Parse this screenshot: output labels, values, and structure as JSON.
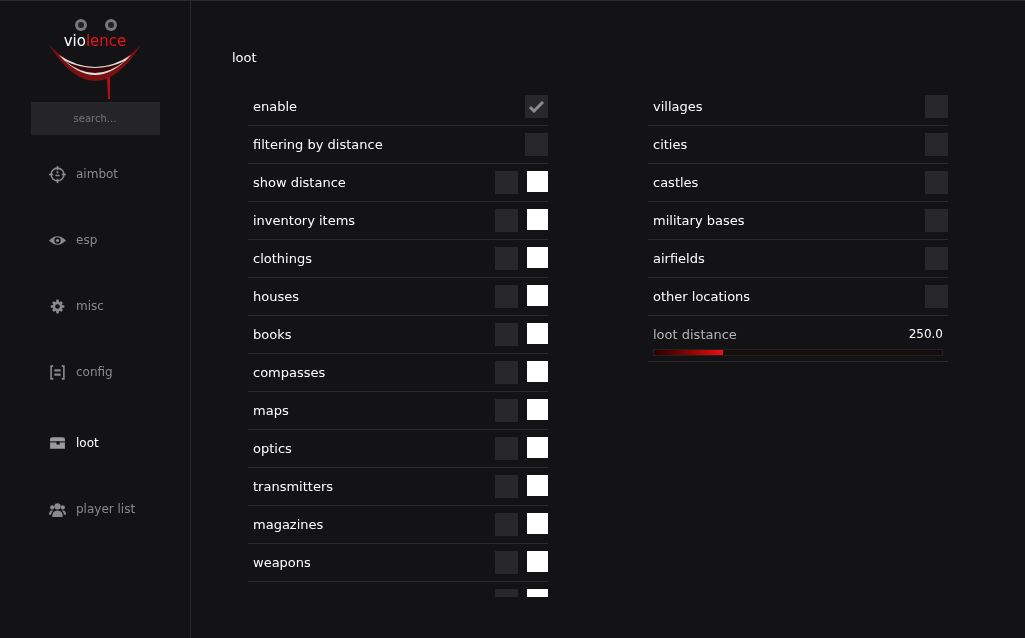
{
  "logo": {
    "parts": [
      {
        "text": "vio",
        "color": "#ffffff"
      },
      {
        "text": "lence",
        "color": "#e5141b"
      }
    ]
  },
  "search": {
    "placeholder": "search..."
  },
  "nav": [
    {
      "label": "aimbot",
      "selected": false
    },
    {
      "label": "esp",
      "selected": false
    },
    {
      "label": "misc",
      "selected": false
    },
    {
      "label": "config",
      "selected": false
    },
    {
      "label": "loot",
      "selected": true
    },
    {
      "label": "player list",
      "selected": false
    }
  ],
  "page_title": "loot",
  "left_options": [
    {
      "kind": "checkbox",
      "label": "enable",
      "checked": true
    },
    {
      "kind": "checkbox",
      "label": "filtering by distance",
      "checked": false
    },
    {
      "kind": "checkbox_color",
      "label": "show distance",
      "checked": false,
      "color": "#ffffff"
    },
    {
      "kind": "checkbox_color",
      "label": "inventory items",
      "checked": false,
      "color": "#ffffff"
    },
    {
      "kind": "checkbox_color",
      "label": "clothings",
      "checked": false,
      "color": "#ffffff"
    },
    {
      "kind": "checkbox_color",
      "label": "houses",
      "checked": false,
      "color": "#ffffff"
    },
    {
      "kind": "checkbox_color",
      "label": "books",
      "checked": false,
      "color": "#ffffff"
    },
    {
      "kind": "checkbox_color",
      "label": "compasses",
      "checked": false,
      "color": "#ffffff"
    },
    {
      "kind": "checkbox_color",
      "label": "maps",
      "checked": false,
      "color": "#ffffff"
    },
    {
      "kind": "checkbox_color",
      "label": "optics",
      "checked": false,
      "color": "#ffffff"
    },
    {
      "kind": "checkbox_color",
      "label": "transmitters",
      "checked": false,
      "color": "#ffffff"
    },
    {
      "kind": "checkbox_color",
      "label": "magazines",
      "checked": false,
      "color": "#ffffff"
    },
    {
      "kind": "checkbox_color",
      "label": "weapons",
      "checked": false,
      "color": "#ffffff"
    },
    {
      "kind": "checkbox_color",
      "checked": false,
      "color": "#ffffff"
    }
  ],
  "right_options": [
    {
      "kind": "checkbox",
      "label": "villages",
      "checked": false
    },
    {
      "kind": "checkbox",
      "label": "cities",
      "checked": false
    },
    {
      "kind": "checkbox",
      "label": "castles",
      "checked": false
    },
    {
      "kind": "checkbox",
      "label": "military bases",
      "checked": false
    },
    {
      "kind": "checkbox",
      "label": "airfields",
      "checked": false
    },
    {
      "kind": "checkbox",
      "label": "other locations",
      "checked": false
    },
    {
      "kind": "slider",
      "label": "loot distance",
      "reading": "250.0",
      "level": 0.24
    }
  ]
}
